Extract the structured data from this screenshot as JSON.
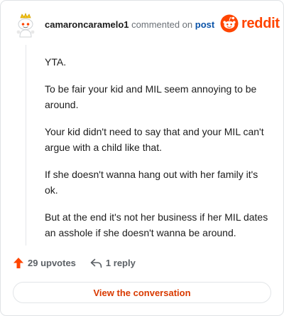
{
  "comment": {
    "username": "camaroncaramelo1",
    "action_text": "commented on",
    "post_link": "post",
    "paragraphs": [
      "YTA.",
      "To be fair your kid and MIL seem annoying to be around.",
      "Your kid didn't need to say that and your MIL can't argue with a child like that.",
      "If she doesn't wanna hang out with her family it's ok.",
      "But at the end it's not her business if her MIL dates an asshole if she doesn't wanna be around."
    ]
  },
  "brand": {
    "name": "reddit",
    "icon": "reddit-logo-icon",
    "color": "#ff4500"
  },
  "stats": {
    "upvotes": "29 upvotes",
    "upvote_icon": "upvote-arrow-icon",
    "replies": "1 reply",
    "reply_icon": "reply-arrow-icon"
  },
  "cta": {
    "label": "View the conversation",
    "color": "#d93a00"
  },
  "colors": {
    "accent": "#ff4500",
    "link": "#0a53a8"
  }
}
